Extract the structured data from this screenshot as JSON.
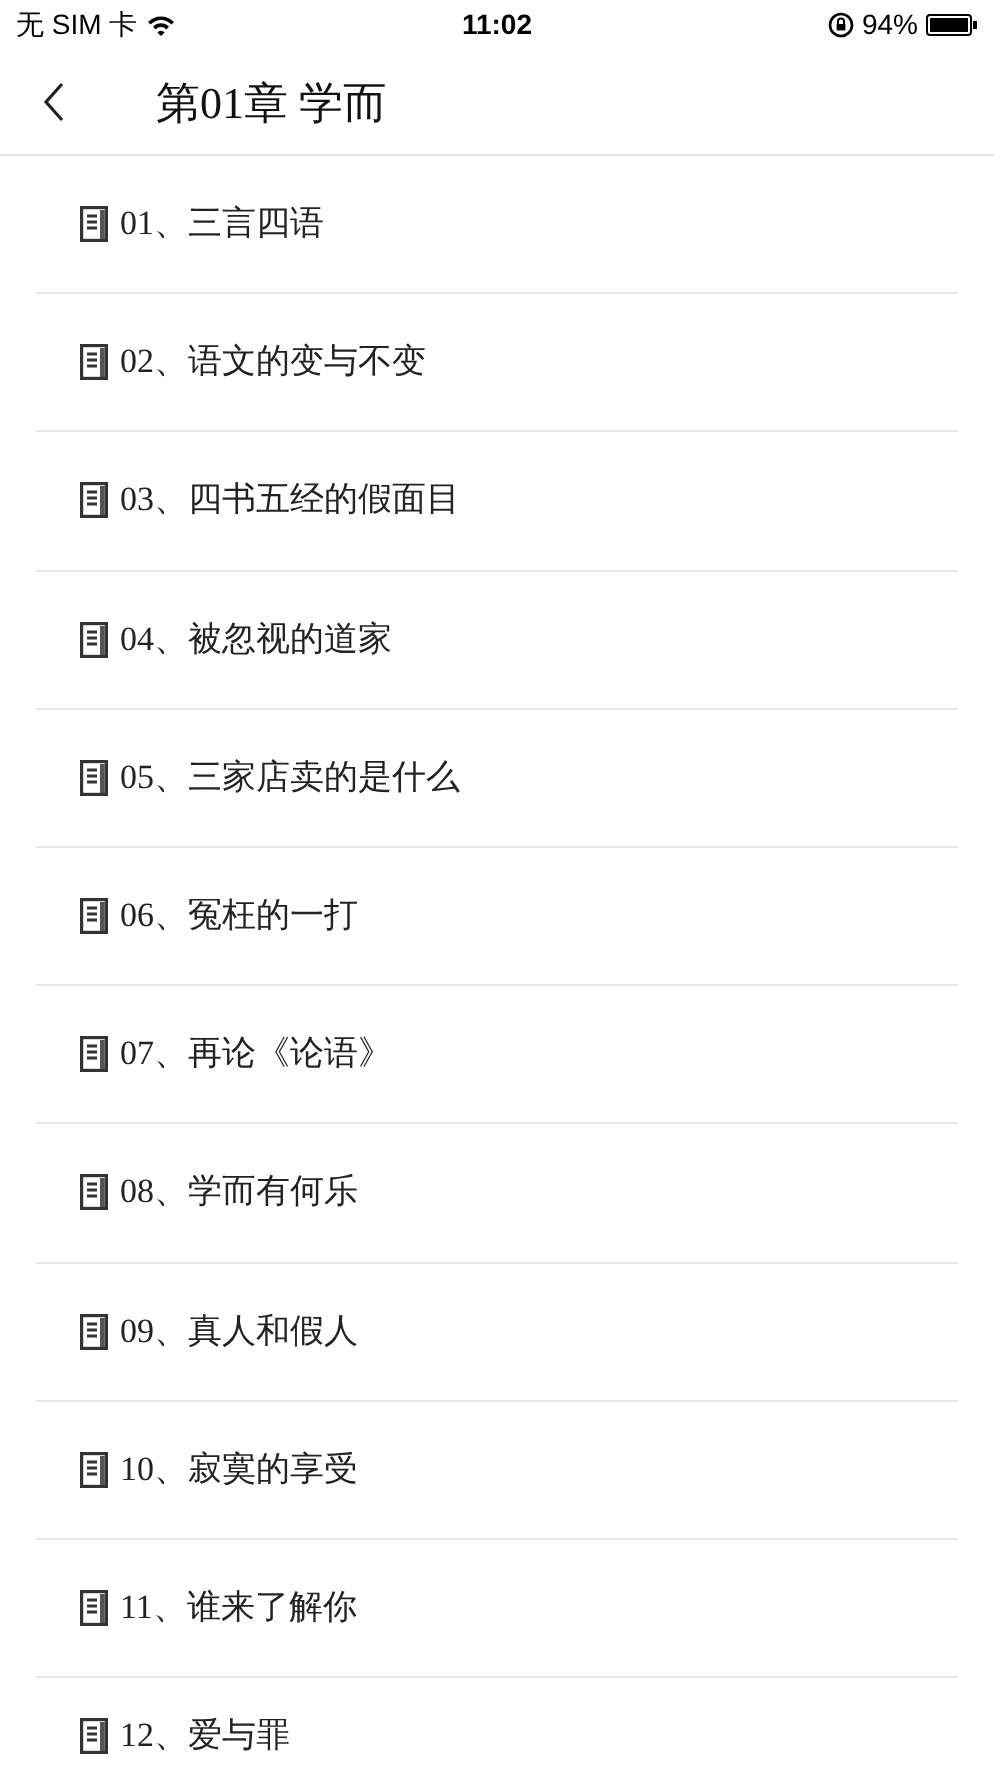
{
  "status_bar": {
    "carrier": "无 SIM 卡",
    "time": "11:02",
    "battery": "94%"
  },
  "nav": {
    "title": "第01章 学而"
  },
  "chapters": [
    {
      "title": "01、三言四语"
    },
    {
      "title": "02、语文的变与不变"
    },
    {
      "title": "03、四书五经的假面目"
    },
    {
      "title": "04、被忽视的道家"
    },
    {
      "title": "05、三家店卖的是什么"
    },
    {
      "title": "06、冤枉的一打"
    },
    {
      "title": "07、再论《论语》"
    },
    {
      "title": "08、学而有何乐"
    },
    {
      "title": "09、真人和假人"
    },
    {
      "title": "10、寂寞的享受"
    },
    {
      "title": "11、谁来了解你"
    },
    {
      "title": "12、爱与罪"
    }
  ]
}
